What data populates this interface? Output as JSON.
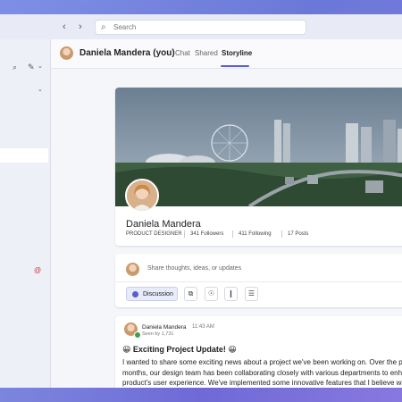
{
  "search": {
    "placeholder": "Search"
  },
  "header": {
    "name": "Daniela Mandera (you)",
    "tabs": [
      {
        "label": "Chat"
      },
      {
        "label": "Shared"
      },
      {
        "label": "Storyline"
      }
    ]
  },
  "profile": {
    "name": "Daniela Mandera",
    "title": "PRODUCT DESIGNER",
    "followers": "341 Followers",
    "following": "411 Following",
    "posts": "17 Posts"
  },
  "composer": {
    "placeholder": "Share thoughts, ideas, or updates",
    "discussion_label": "Discussion"
  },
  "post": {
    "author": "Daniela Mandera",
    "time": "11:43 AM",
    "seen": "Seen by 1,731",
    "title": "😀 Exciting Project Update! 😀",
    "body": "I wanted to share some exciting news about a project we've been working on. Over the past\nmonths, our design team has been collaborating closely with various departments to enhanc\nproduct's user experience. We've implemented some innovative features that I believe will si\nimprove our customers' interactions with our platform."
  },
  "colors": {
    "accent": "#5b5fc7",
    "presence": "#3da04a"
  }
}
